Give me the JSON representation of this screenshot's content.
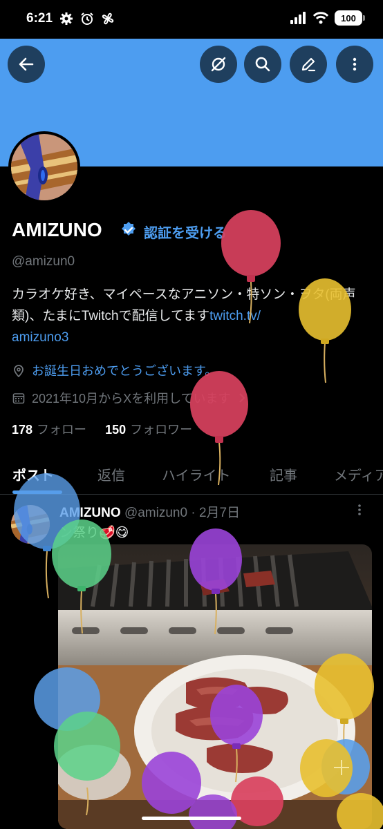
{
  "status_bar": {
    "time": "6:21",
    "battery": "100"
  },
  "header": {
    "back_icon": "back-arrow-icon",
    "actions": [
      "grok-icon",
      "search-icon",
      "edit-icon",
      "more-icon"
    ]
  },
  "profile": {
    "name": "AMIZUNO",
    "verify_cta": "認証を受ける",
    "handle": "@amizun0",
    "bio_text": "カラオケ好き、マイペースなアニソン・特ソン・ヲタ(両声類)、たまにTwitchで配信してます",
    "bio_link_1": "twitch.tv/",
    "bio_link_2": "amizuno3",
    "birthday": "お誕生日おめでとうございます。",
    "joined": "2021年10月からXを利用しています",
    "following_count": "178",
    "following_label": "フォロー",
    "followers_count": "150",
    "followers_label": "フォロワー"
  },
  "tabs": [
    "ポスト",
    "返信",
    "ハイライト",
    "記事",
    "メディア"
  ],
  "post": {
    "author": "AMIZUNO",
    "handle": "@amizun0",
    "separator": "·",
    "date": "2月7日",
    "text": "ン祭り🥩😋"
  },
  "colors": {
    "accent": "#4d9df0",
    "banner": "#4d9df0",
    "background": "#000000",
    "secondary_text": "#71767b"
  }
}
